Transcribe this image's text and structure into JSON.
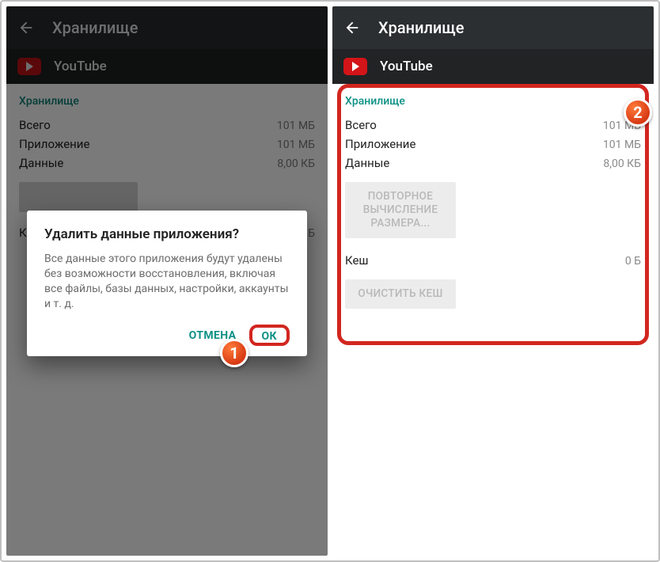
{
  "left": {
    "appbar": {
      "title": "Хранилище"
    },
    "subheader": {
      "app": "YouTube"
    },
    "section": {
      "label": "Хранилище"
    },
    "rows": {
      "total": {
        "label": "Всего",
        "value": "101 МБ"
      },
      "app": {
        "label": "Приложение",
        "value": "101 МБ"
      },
      "data": {
        "label": "Данные",
        "value": "8,00 КБ"
      }
    },
    "cache_row": {
      "label": "К",
      "value": "Б"
    },
    "dialog": {
      "title": "Удалить данные приложения?",
      "body": "Все данные этого приложения будут удалены без возможности восстановления, включая все файлы, базы данных, настройки, аккаунты и т. д.",
      "cancel": "ОТМЕНА",
      "ok": "ОК"
    },
    "badge": "1"
  },
  "right": {
    "appbar": {
      "title": "Хранилище"
    },
    "subheader": {
      "app": "YouTube"
    },
    "section": {
      "label": "Хранилище"
    },
    "rows": {
      "total": {
        "label": "Всего",
        "value": "101 МБ"
      },
      "app": {
        "label": "Приложение",
        "value": "101 МБ"
      },
      "data": {
        "label": "Данные",
        "value": "8,00 КБ"
      }
    },
    "btn_recalc": "ПОВТОРНОЕ\nВЫЧИСЛЕНИЕ\nРАЗМЕРА...",
    "cache_row": {
      "label": "Кеш",
      "value": "0 Б"
    },
    "btn_clear": "ОЧИСТИТЬ КЕШ",
    "badge": "2"
  }
}
